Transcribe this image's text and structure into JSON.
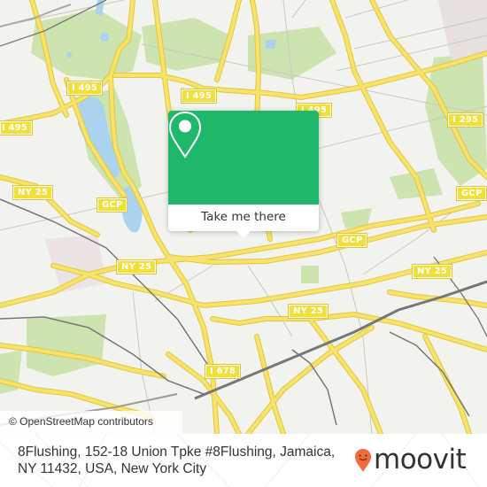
{
  "map": {
    "colors": {
      "background": "#f2f2ef",
      "road": "#f7e26b",
      "road_edge": "#e7cf4a",
      "park": "#cde3b0",
      "water": "#a9d3ee",
      "rail": "#777777",
      "minor_road": "#c9c9c4"
    },
    "shields": [
      {
        "label": "I 495"
      },
      {
        "label": "I 495"
      },
      {
        "label": "I 495"
      },
      {
        "label": "I 495"
      },
      {
        "label": "I 295"
      },
      {
        "label": "NY 25"
      },
      {
        "label": "GCP"
      },
      {
        "label": "GCP"
      },
      {
        "label": "GCP"
      },
      {
        "label": "NY 25"
      },
      {
        "label": "NY 25"
      },
      {
        "label": "NY 25"
      },
      {
        "label": "I 678"
      }
    ],
    "attribution": "© OpenStreetMap contributors"
  },
  "popup": {
    "icon": "map-pin-icon",
    "button_label": "Take me there",
    "header_color": "#1fb86b"
  },
  "footer": {
    "address": "8Flushing, 152-18 Union Tpke #8Flushing, Jamaica, NY 11432, USA, New York City",
    "brand": {
      "name": "moovit",
      "icon": "moovit-pin-logo-icon",
      "color": "#f26b3a"
    }
  }
}
